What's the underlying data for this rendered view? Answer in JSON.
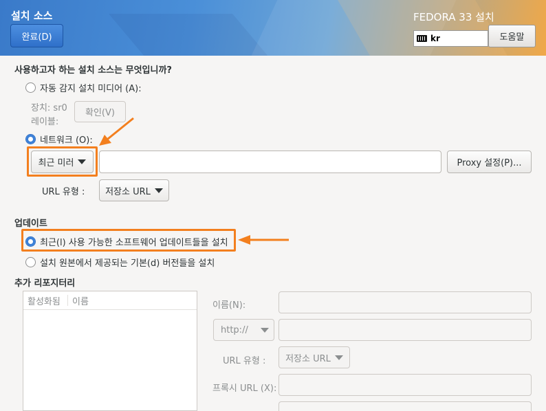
{
  "header": {
    "title": "설치 소스",
    "done_label": "완료(D)",
    "product": "FEDORA 33 설치",
    "keyboard": "kr",
    "help_label": "도움말"
  },
  "source": {
    "question": "사용하고자 하는 설치 소스는 무엇입니까?",
    "auto_detect_label": "자동 감지 설치 미디어 (A):",
    "device_label": "장치: sr0",
    "label_label": "레이블:",
    "verify_label": "확인(V)",
    "network_label": "네트워크 (O):",
    "mirror_dropdown": "최근 미러",
    "url_value": "",
    "proxy_label": "Proxy 설정(P)...",
    "url_type_label": "URL 유형 :",
    "url_type_value": "저장소 URL"
  },
  "updates": {
    "heading": "업데이트",
    "latest_label": "최근(l) 사용 가능한 소프트웨어 업데이트들을 설치",
    "base_label": "설치 원본에서 제공되는 기본(d) 버전들을 설치"
  },
  "repos": {
    "heading": "추가 리포지터리",
    "col_enabled": "활성화됨",
    "col_name": "이름",
    "name_label": "이름(N):",
    "protocol_value": "http://",
    "url_type_label": "URL 유형 :",
    "url_type_value": "저장소 URL",
    "proxy_url_label": "프록시 URL (X):"
  },
  "colors": {
    "accent": "#3b80d8",
    "highlight": "#f37f1e"
  }
}
